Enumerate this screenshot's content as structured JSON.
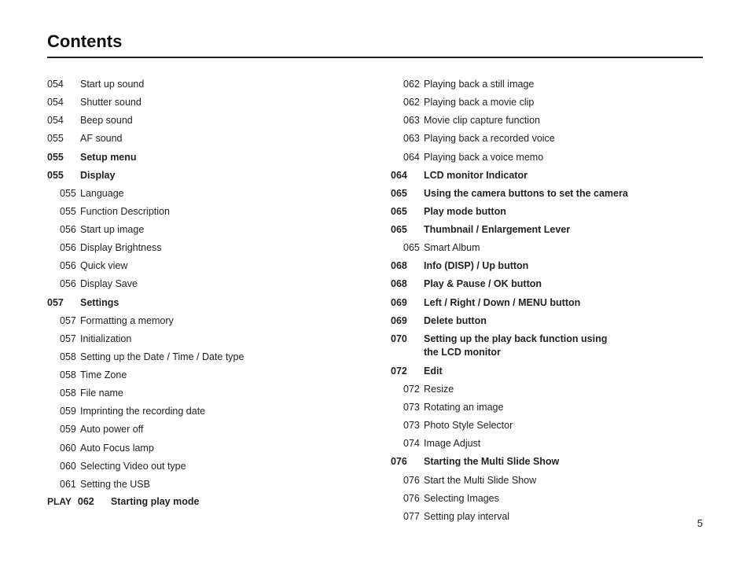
{
  "header": {
    "title": "Contents"
  },
  "left_column": [
    {
      "num": "054",
      "label": "Start up sound",
      "bold": false,
      "indent": false
    },
    {
      "num": "054",
      "label": "Shutter sound",
      "bold": false,
      "indent": false
    },
    {
      "num": "054",
      "label": "Beep sound",
      "bold": false,
      "indent": false
    },
    {
      "num": "055",
      "label": "AF sound",
      "bold": false,
      "indent": false
    },
    {
      "num": "055",
      "label": "Setup menu",
      "bold": true,
      "indent": false
    },
    {
      "num": "055",
      "label": "Display",
      "bold": true,
      "indent": false
    },
    {
      "num": "055",
      "label": "Language",
      "bold": false,
      "indent": true
    },
    {
      "num": "055",
      "label": "Function Description",
      "bold": false,
      "indent": true
    },
    {
      "num": "056",
      "label": "Start up image",
      "bold": false,
      "indent": true
    },
    {
      "num": "056",
      "label": "Display Brightness",
      "bold": false,
      "indent": true
    },
    {
      "num": "056",
      "label": "Quick view",
      "bold": false,
      "indent": true
    },
    {
      "num": "056",
      "label": "Display Save",
      "bold": false,
      "indent": true
    },
    {
      "num": "057",
      "label": "Settings",
      "bold": true,
      "indent": false
    },
    {
      "num": "057",
      "label": "Formatting a memory",
      "bold": false,
      "indent": true
    },
    {
      "num": "057",
      "label": "Initialization",
      "bold": false,
      "indent": true
    },
    {
      "num": "058",
      "label": "Setting up the Date / Time / Date type",
      "bold": false,
      "indent": true
    },
    {
      "num": "058",
      "label": "Time Zone",
      "bold": false,
      "indent": true
    },
    {
      "num": "058",
      "label": "File name",
      "bold": false,
      "indent": true
    },
    {
      "num": "059",
      "label": "Imprinting the recording date",
      "bold": false,
      "indent": true
    },
    {
      "num": "059",
      "label": "Auto power off",
      "bold": false,
      "indent": true
    },
    {
      "num": "060",
      "label": "Auto Focus lamp",
      "bold": false,
      "indent": true
    },
    {
      "num": "060",
      "label": "Selecting Video out type",
      "bold": false,
      "indent": true
    },
    {
      "num": "061",
      "label": "Setting the USB",
      "bold": false,
      "indent": true
    }
  ],
  "right_column": [
    {
      "num": "062",
      "label": "Playing back a still image",
      "bold": false,
      "indent": true
    },
    {
      "num": "062",
      "label": "Playing back a movie clip",
      "bold": false,
      "indent": true
    },
    {
      "num": "063",
      "label": "Movie clip capture function",
      "bold": false,
      "indent": true
    },
    {
      "num": "063",
      "label": "Playing back a recorded voice",
      "bold": false,
      "indent": true
    },
    {
      "num": "064",
      "label": "Playing back a voice memo",
      "bold": false,
      "indent": true
    },
    {
      "num": "064",
      "label": "LCD monitor Indicator",
      "bold": true,
      "indent": false
    },
    {
      "num": "065",
      "label": "Using the camera buttons to set the camera",
      "bold": true,
      "indent": false
    },
    {
      "num": "065",
      "label": "Play mode button",
      "bold": true,
      "indent": false
    },
    {
      "num": "065",
      "label": "Thumbnail / Enlargement Lever",
      "bold": true,
      "indent": false
    },
    {
      "num": "065",
      "label": "Smart Album",
      "bold": false,
      "indent": true
    },
    {
      "num": "068",
      "label": "Info (DISP) / Up button",
      "bold": true,
      "indent": false
    },
    {
      "num": "068",
      "label": "Play & Pause / OK button",
      "bold": true,
      "indent": false
    },
    {
      "num": "069",
      "label": "Left / Right / Down / MENU button",
      "bold": true,
      "indent": false
    },
    {
      "num": "069",
      "label": "Delete button",
      "bold": true,
      "indent": false
    },
    {
      "num": "070",
      "label": "Setting up the play back function using\nthe LCD monitor",
      "bold": true,
      "indent": false,
      "multiline": true
    },
    {
      "num": "072",
      "label": "Edit",
      "bold": true,
      "indent": false
    },
    {
      "num": "072",
      "label": "Resize",
      "bold": false,
      "indent": true
    },
    {
      "num": "073",
      "label": "Rotating an image",
      "bold": false,
      "indent": true
    },
    {
      "num": "073",
      "label": "Photo Style Selector",
      "bold": false,
      "indent": true
    },
    {
      "num": "074",
      "label": "Image Adjust",
      "bold": false,
      "indent": true
    },
    {
      "num": "076",
      "label": "Starting the Multi Slide Show",
      "bold": true,
      "indent": false
    },
    {
      "num": "076",
      "label": "Start the Multi Slide Show",
      "bold": false,
      "indent": true
    },
    {
      "num": "076",
      "label": "Selecting Images",
      "bold": false,
      "indent": true
    },
    {
      "num": "077",
      "label": "Setting play interval",
      "bold": false,
      "indent": true
    }
  ],
  "play_section": {
    "tag": "PLAY",
    "num": "062",
    "label": "Starting play mode"
  },
  "page_number": "5"
}
